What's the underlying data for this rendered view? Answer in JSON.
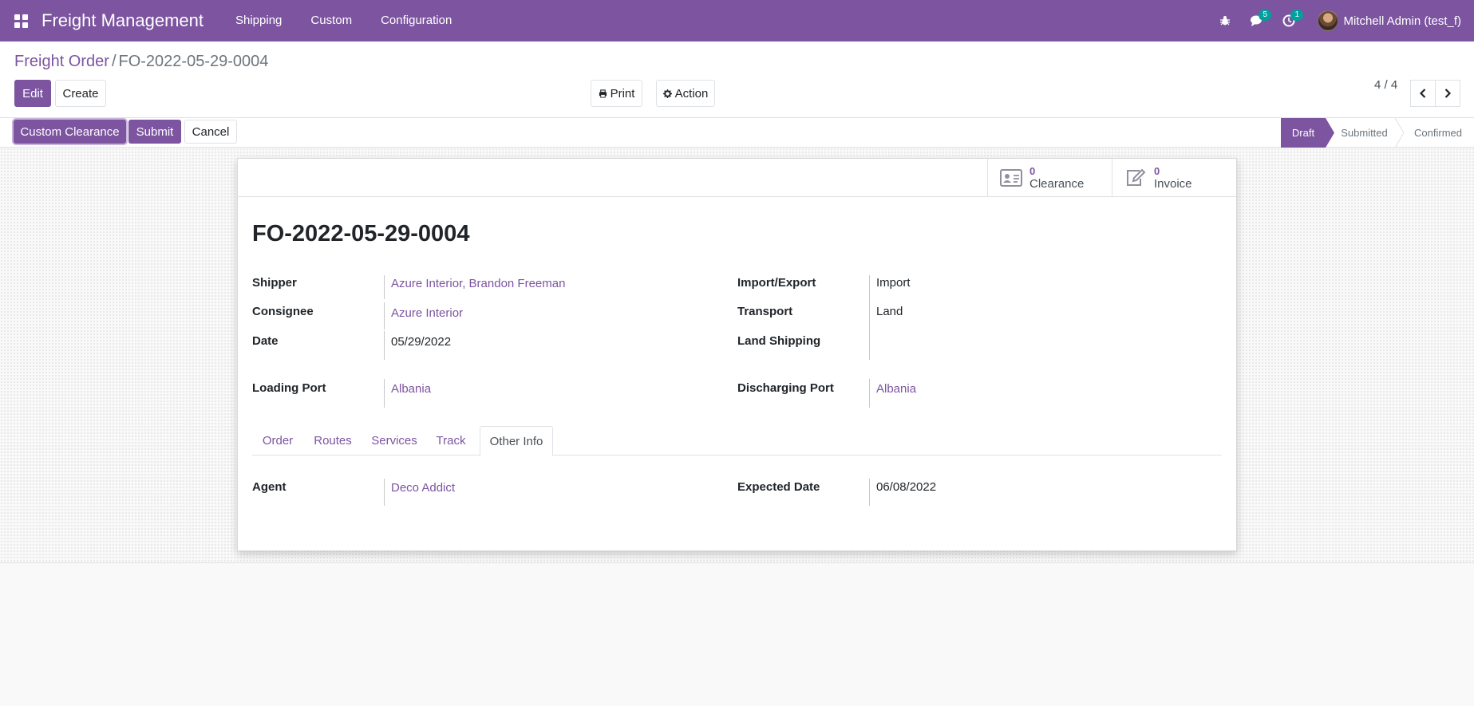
{
  "navbar": {
    "app_name": "Freight Management",
    "menu": [
      {
        "label": "Shipping"
      },
      {
        "label": "Custom"
      },
      {
        "label": "Configuration"
      }
    ],
    "messages_badge": "5",
    "activities_badge": "1",
    "user_name": "Mitchell Admin (test_f)",
    "icons": [
      "apps-grid-icon",
      "bug-icon",
      "comments-icon",
      "clock-icon"
    ]
  },
  "breadcrumb": {
    "parent": "Freight Order",
    "separator": "/",
    "current": "FO-2022-05-29-0004"
  },
  "toolbar": {
    "edit_label": "Edit",
    "create_label": "Create",
    "print_label": "Print",
    "action_label": "Action"
  },
  "pager": {
    "value": "4 / 4"
  },
  "header_buttons": {
    "custom_clearance_label": "Custom Clearance",
    "submit_label": "Submit",
    "cancel_label": "Cancel"
  },
  "statusbar": {
    "stages": [
      {
        "label": "Draft",
        "active": true
      },
      {
        "label": "Submitted",
        "active": false
      },
      {
        "label": "Confirmed",
        "active": false
      }
    ]
  },
  "smart_buttons": [
    {
      "count": "0",
      "label": "Clearance",
      "icon": "id-card-icon"
    },
    {
      "count": "0",
      "label": "Invoice",
      "icon": "edit-icon"
    }
  ],
  "record": {
    "title": "FO-2022-05-29-0004",
    "left_fields": [
      {
        "label": "Shipper",
        "value": "Azure Interior, Brandon Freeman",
        "link": true
      },
      {
        "label": "Consignee",
        "value": "Azure Interior",
        "link": true
      },
      {
        "label": "Date",
        "value": "05/29/2022",
        "link": false
      }
    ],
    "right_fields": [
      {
        "label": "Import/Export",
        "value": "Import",
        "link": false
      },
      {
        "label": "Transport",
        "value": "Land",
        "link": false
      },
      {
        "label": "Land Shipping",
        "value": "",
        "link": false
      }
    ],
    "loading_port": {
      "label": "Loading Port",
      "value": "Albania"
    },
    "discharging_port": {
      "label": "Discharging Port",
      "value": "Albania"
    }
  },
  "tabs": [
    {
      "label": "Order",
      "active": false
    },
    {
      "label": "Routes",
      "active": false
    },
    {
      "label": "Services",
      "active": false
    },
    {
      "label": "Track",
      "active": false
    },
    {
      "label": "Other Info",
      "active": true
    }
  ],
  "other_info": {
    "agent": {
      "label": "Agent",
      "value": "Deco Addict"
    },
    "expected_date": {
      "label": "Expected Date",
      "value": "06/08/2022"
    }
  },
  "colors": {
    "brand": "#7c54a0",
    "badge": "#00a09d"
  }
}
